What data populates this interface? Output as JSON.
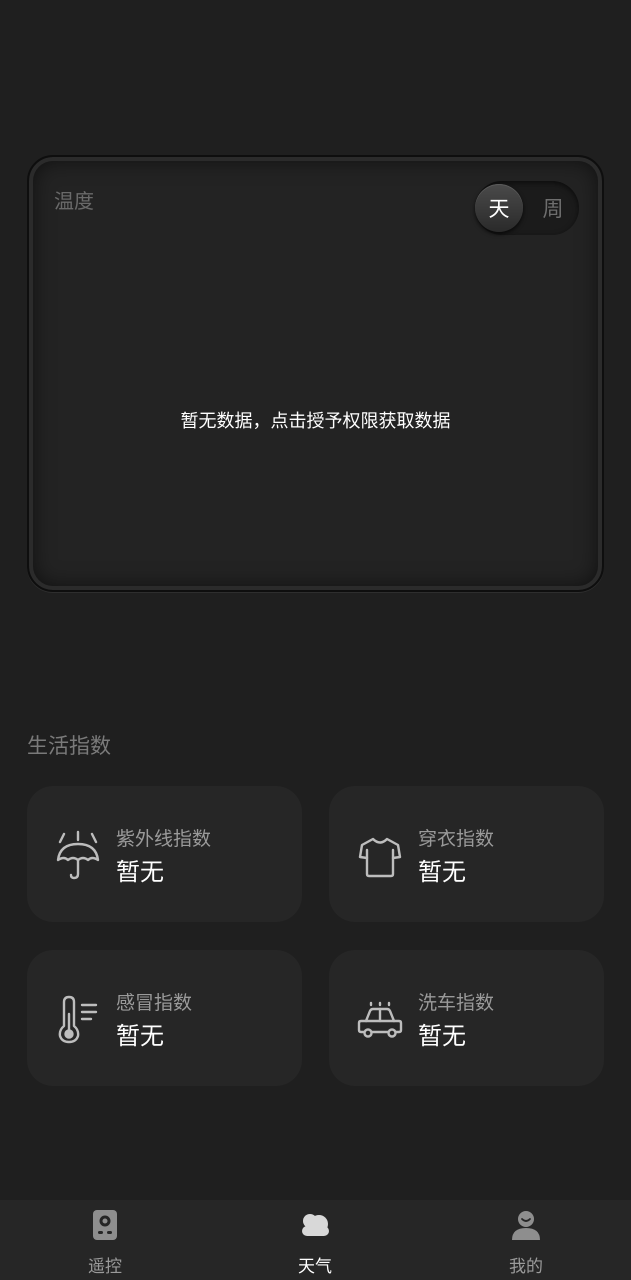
{
  "temperature_card": {
    "title": "温度",
    "toggle": {
      "day": "天",
      "week": "周",
      "selected": "天"
    },
    "empty_message": "暂无数据，点击授予权限获取数据"
  },
  "life_index": {
    "title": "生活指数",
    "items": [
      {
        "label": "紫外线指数",
        "value": "暂无",
        "icon": "umbrella-sun-icon"
      },
      {
        "label": "穿衣指数",
        "value": "暂无",
        "icon": "shirt-icon"
      },
      {
        "label": "感冒指数",
        "value": "暂无",
        "icon": "thermometer-icon"
      },
      {
        "label": "洗车指数",
        "value": "暂无",
        "icon": "car-wash-icon"
      }
    ]
  },
  "bottom_nav": {
    "items": [
      {
        "label": "遥控",
        "icon": "remote-icon",
        "active": false
      },
      {
        "label": "天气",
        "icon": "cloud-icon",
        "active": true
      },
      {
        "label": "我的",
        "icon": "person-icon",
        "active": false
      }
    ]
  },
  "colors": {
    "background": "#1f1f1f",
    "card": "#262626",
    "text_primary": "#ffffff",
    "text_secondary": "#9a9a9a"
  }
}
